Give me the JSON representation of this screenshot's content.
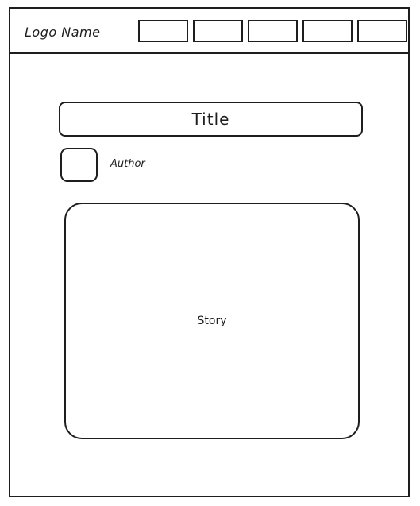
{
  "header": {
    "logo": "Logo Name",
    "nav_items": [
      "",
      "",
      "",
      "",
      ""
    ]
  },
  "content": {
    "title": "Title",
    "author": "Author",
    "story": "Story"
  }
}
